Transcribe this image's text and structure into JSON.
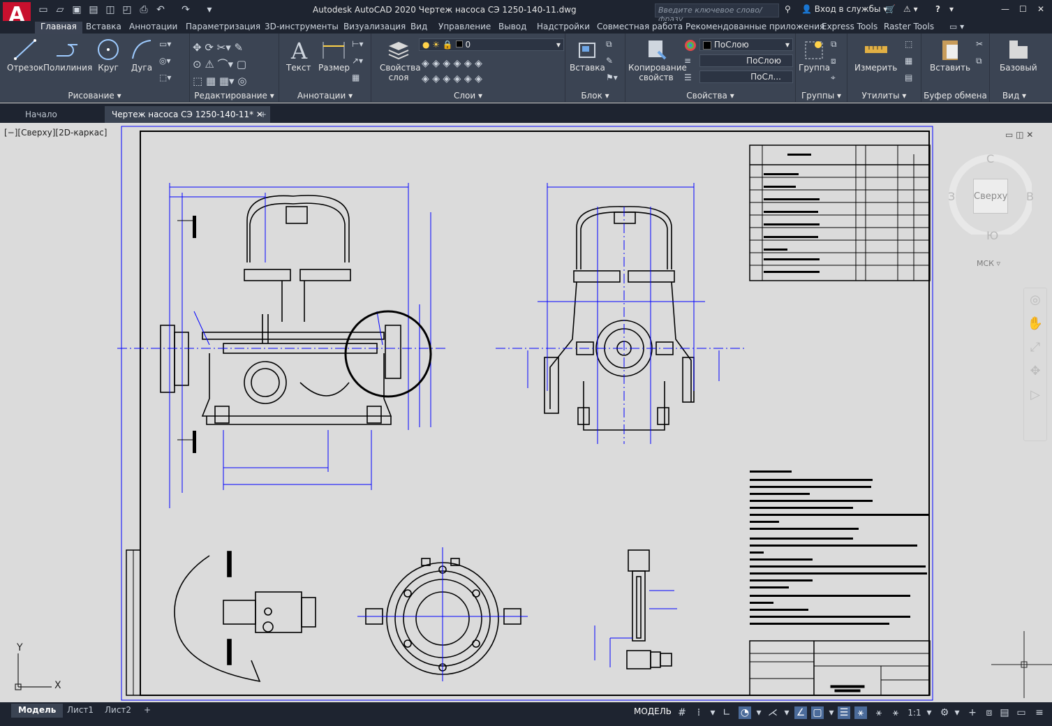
{
  "app": {
    "logo_letter": "A",
    "title": "Autodesk AutoCAD 2020   Чертеж насоса СЭ 1250-140-11.dwg",
    "search_placeholder": "Введите ключевое слово/фразу",
    "signin": "Вход в службы",
    "help": "?"
  },
  "ribbon_tabs": [
    "Главная",
    "Вставка",
    "Аннотации",
    "Параметризация",
    "3D-инструменты",
    "Визуализация",
    "Вид",
    "Управление",
    "Вывод",
    "Надстройки",
    "Совместная работа",
    "Рекомендованные приложения",
    "Express Tools",
    "Raster Tools"
  ],
  "panels": {
    "draw": {
      "title": "Рисование",
      "buttons": [
        "Отрезок",
        "Полилиния",
        "Круг",
        "Дуга"
      ]
    },
    "modify": {
      "title": "Редактирование"
    },
    "annotation": {
      "title": "Аннотации",
      "buttons": [
        "Текст",
        "Размер"
      ]
    },
    "layers": {
      "title": "Слои",
      "button": "Свойства слоя",
      "current_layer": "0"
    },
    "block": {
      "title": "Блок",
      "button": "Вставка"
    },
    "properties": {
      "title": "Свойства",
      "button": "Копирование свойств",
      "color": "ПоСлою",
      "linetype": "ПоСлою",
      "lineweight": "ПоСл..."
    },
    "groups": {
      "title": "Группы",
      "button": "Группа"
    },
    "utilities": {
      "title": "Утилиты",
      "button": "Измерить"
    },
    "clipboard": {
      "title": "Буфер обмена",
      "button": "Вставить"
    },
    "view": {
      "title": "Вид",
      "button": "Базовый"
    }
  },
  "doc_tabs": [
    "Начало",
    "Чертеж насоса СЭ 1250-140-11*"
  ],
  "viewport": {
    "label": "[−][Сверху][2D-каркас]",
    "navcube": {
      "top": "Сверху",
      "north": "С",
      "south": "Ю",
      "west": "З",
      "east": "В"
    },
    "wcs": "МСК",
    "ucs_x": "X",
    "ucs_y": "Y"
  },
  "layout_tabs": [
    "Модель",
    "Лист1",
    "Лист2"
  ],
  "status": {
    "model": "МОДЕЛЬ",
    "scale": "1:1"
  }
}
